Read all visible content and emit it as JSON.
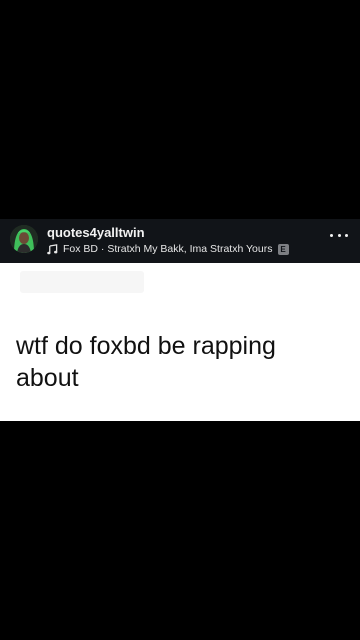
{
  "post": {
    "username": "quotes4yalltwin",
    "music": {
      "icon": "music-note-icon",
      "track": "Fox BD · Stratxh My Bakk, Ima Stratxh Yours",
      "explicit_label": "E"
    },
    "more_icon": "more-horizontal-icon"
  },
  "content": {
    "quote": "wtf do foxbd be rapping about"
  },
  "colors": {
    "background": "#000000",
    "header_background": "#111418",
    "card_background": "#ffffff",
    "text_dark": "#111111",
    "text_light": "#f2f2f2"
  }
}
